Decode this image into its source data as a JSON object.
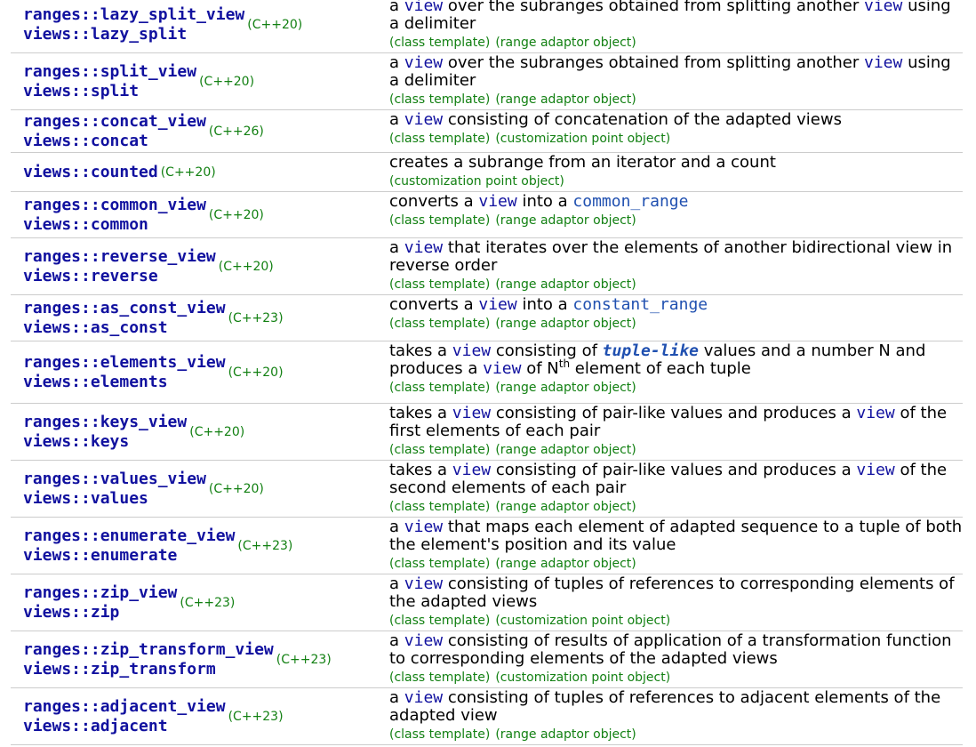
{
  "rows": [
    {
      "names": [
        "ranges::lazy_split_view",
        "views::lazy_split"
      ],
      "version": "(C++20)",
      "desc": [
        "a ",
        {
          "c": "view"
        },
        " over the subranges obtained from splitting another ",
        {
          "c": "view"
        },
        " using a delimiter"
      ],
      "tags": [
        "(class template)",
        "(range adaptor object)"
      ]
    },
    {
      "names": [
        "ranges::split_view",
        "views::split"
      ],
      "version": "(C++20)",
      "desc": [
        "a ",
        {
          "c": "view"
        },
        " over the subranges obtained from splitting another ",
        {
          "c": "view"
        },
        " using a delimiter"
      ],
      "tags": [
        "(class template)",
        "(range adaptor object)"
      ]
    },
    {
      "names": [
        "ranges::concat_view",
        "views::concat"
      ],
      "version": "(C++26)",
      "desc": [
        "a ",
        {
          "c": "view"
        },
        " consisting of concatenation of the adapted views"
      ],
      "tags": [
        "(class template)",
        "(customization point object)"
      ]
    },
    {
      "names": [
        "views::counted"
      ],
      "version": "(C++20)",
      "desc": [
        "creates a subrange from an iterator and a count"
      ],
      "tags": [
        "(customization point object)"
      ]
    },
    {
      "names": [
        "ranges::common_view",
        "views::common"
      ],
      "version": "(C++20)",
      "desc": [
        "converts a ",
        {
          "c": "view"
        },
        " into a ",
        {
          "l": "common_range"
        }
      ],
      "tags": [
        "(class template)",
        "(range adaptor object)"
      ]
    },
    {
      "names": [
        "ranges::reverse_view",
        "views::reverse"
      ],
      "version": "(C++20)",
      "desc": [
        "a ",
        {
          "c": "view"
        },
        " that iterates over the elements of another bidirectional view in reverse order"
      ],
      "tags": [
        "(class template)",
        "(range adaptor object)"
      ]
    },
    {
      "names": [
        "ranges::as_const_view",
        "views::as_const"
      ],
      "version": "(C++23)",
      "desc": [
        "converts a ",
        {
          "c": "view"
        },
        " into a ",
        {
          "l": "constant_range"
        }
      ],
      "tags": [
        "(class template)",
        "(range adaptor object)"
      ]
    },
    {
      "names": [
        "ranges::elements_view",
        "views::elements"
      ],
      "version": "(C++20)",
      "desc": [
        "takes a ",
        {
          "c": "view"
        },
        " consisting of ",
        {
          "i": "tuple-like"
        },
        " values and a number N and produces a ",
        {
          "c": "view"
        },
        " of N",
        {
          "s": "th"
        },
        " element of each tuple"
      ],
      "tags": [
        "(class template)",
        "(range adaptor object)"
      ]
    },
    {
      "names": [
        "ranges::keys_view",
        "views::keys"
      ],
      "version": "(C++20)",
      "desc": [
        "takes a ",
        {
          "c": "view"
        },
        " consisting of pair-like values and produces a ",
        {
          "c": "view"
        },
        " of the first elements of each pair"
      ],
      "tags": [
        "(class template)",
        "(range adaptor object)"
      ]
    },
    {
      "names": [
        "ranges::values_view",
        "views::values"
      ],
      "version": "(C++20)",
      "desc": [
        "takes a ",
        {
          "c": "view"
        },
        " consisting of pair-like values and produces a ",
        {
          "c": "view"
        },
        " of the second elements of each pair"
      ],
      "tags": [
        "(class template)",
        "(range adaptor object)"
      ]
    },
    {
      "names": [
        "ranges::enumerate_view",
        "views::enumerate"
      ],
      "version": "(C++23)",
      "desc": [
        "a ",
        {
          "c": "view"
        },
        " that maps each element of adapted sequence to a tuple of both the element's position and its value"
      ],
      "tags": [
        "(class template)",
        "(range adaptor object)"
      ]
    },
    {
      "names": [
        "ranges::zip_view",
        "views::zip"
      ],
      "version": "(C++23)",
      "desc": [
        "a ",
        {
          "c": "view"
        },
        " consisting of tuples of references to corresponding elements of the adapted views"
      ],
      "tags": [
        "(class template)",
        "(customization point object)"
      ]
    },
    {
      "names": [
        "ranges::zip_transform_view",
        "views::zip_transform"
      ],
      "version": "(C++23)",
      "desc": [
        "a ",
        {
          "c": "view"
        },
        " consisting of results of application of a transformation function to corresponding elements of the adapted views"
      ],
      "tags": [
        "(class template)",
        "(customization point object)"
      ]
    },
    {
      "names": [
        "ranges::adjacent_view",
        "views::adjacent"
      ],
      "version": "(C++23)",
      "desc": [
        "a ",
        {
          "c": "view"
        },
        " consisting of tuples of references to adjacent elements of the adapted view"
      ],
      "tags": [
        "(class template)",
        "(range adaptor object)"
      ]
    }
  ]
}
